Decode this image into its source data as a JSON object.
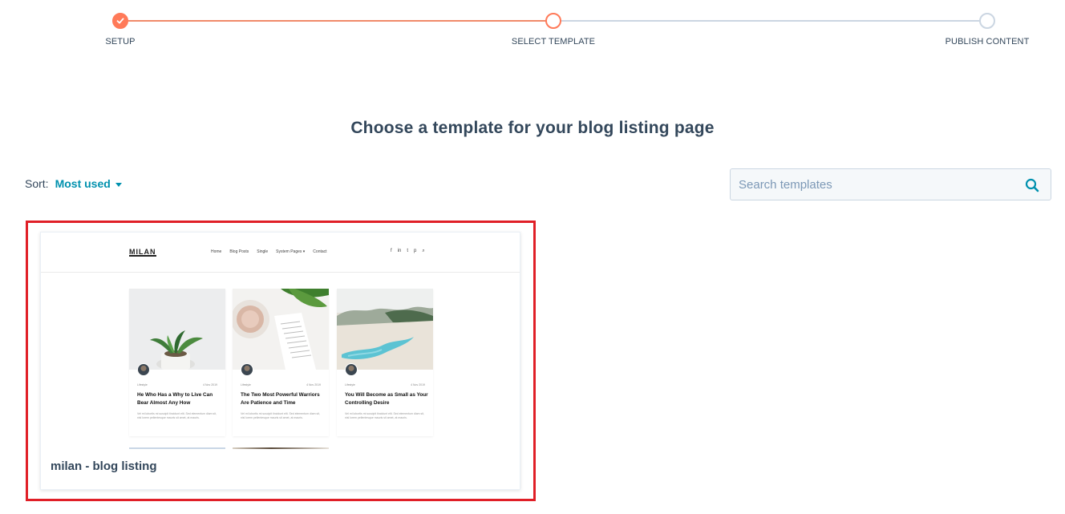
{
  "stepper": {
    "steps": [
      {
        "label": "SETUP",
        "state": "complete"
      },
      {
        "label": "SELECT TEMPLATE",
        "state": "current"
      },
      {
        "label": "PUBLISH CONTENT",
        "state": "upcoming"
      }
    ]
  },
  "page": {
    "title": "Choose a template for your blog listing page"
  },
  "sort": {
    "label": "Sort:",
    "value": "Most used"
  },
  "search": {
    "placeholder": "Search templates"
  },
  "templates": [
    {
      "name": "milan - blog listing",
      "preview": {
        "logo": "MILAN",
        "menu": [
          "Home",
          "Blog Posts",
          "Single",
          "System Pages ▾",
          "Contact"
        ],
        "social": [
          "f",
          "in",
          "t",
          "p",
          "⌕"
        ],
        "posts": [
          {
            "category": "Lifestyle",
            "date": "4 Nov 2019",
            "title": "He Who Has a Why to Live Can Bear Almost Any How",
            "excerpt": "Vel mi lobortis mi suscipit tincidunt elit. Sed elementum diam sit, nisl lorem pellentesque mauris sit amet, at mauris."
          },
          {
            "category": "Lifestyle",
            "date": "4 Nov 2019",
            "title": "The Two Most Powerful Warriors Are Patience and Time",
            "excerpt": "Vel mi lobortis mi suscipit tincidunt elit. Sed elementum diam sit, nisl lorem pellentesque mauris sit amet, at mauris."
          },
          {
            "category": "Lifestyle",
            "date": "4 Nov 2019",
            "title": "You Will Become as Small as Your Controlling Desire",
            "excerpt": "Vel mi lobortis mi suscipit tincidunt elit. Sed elementum diam sit, nisl lorem pellentesque mauris sit amet, at mauris."
          }
        ]
      }
    }
  ],
  "colors": {
    "accent": "#ff7a59",
    "link": "#0091ae",
    "text": "#33475b",
    "highlight": "#e01f27"
  }
}
